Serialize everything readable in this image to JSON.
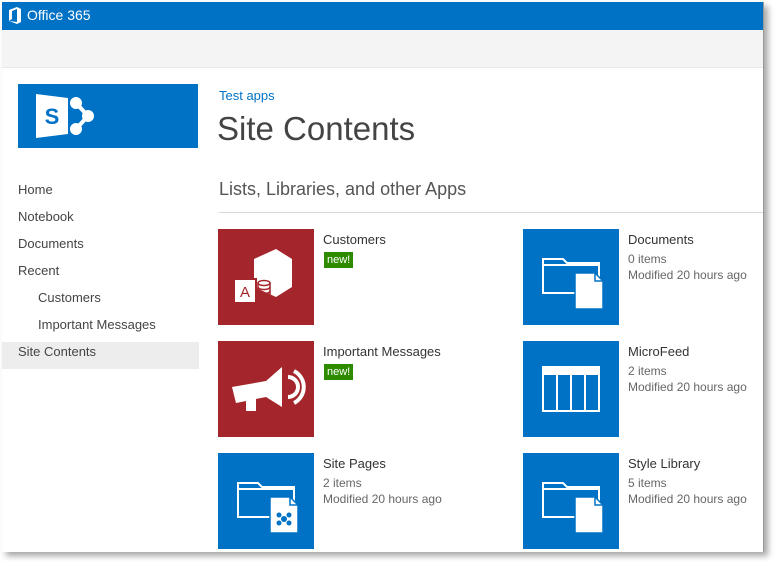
{
  "suite": {
    "brand": "Office 365"
  },
  "breadcrumb": "Test apps",
  "page_title": "Site Contents",
  "section_heading": "Lists, Libraries, and other Apps",
  "quicklaunch": {
    "items": [
      {
        "label": "Home"
      },
      {
        "label": "Notebook"
      },
      {
        "label": "Documents"
      },
      {
        "label": "Recent"
      },
      {
        "label": "Customers"
      },
      {
        "label": "Important Messages"
      },
      {
        "label": "Site Contents"
      }
    ]
  },
  "apps": [
    {
      "title": "Customers",
      "badge": "new!",
      "icon": "access-app-icon",
      "color": "#a4262c"
    },
    {
      "title": "Documents",
      "count": "0 items",
      "modified": "Modified 20 hours ago",
      "icon": "document-library-icon",
      "color": "#0072c6"
    },
    {
      "title": "Important Messages",
      "badge": "new!",
      "icon": "megaphone-icon",
      "color": "#a4262c"
    },
    {
      "title": "MicroFeed",
      "count": "2 items",
      "modified": "Modified 20 hours ago",
      "icon": "list-icon",
      "color": "#0072c6"
    },
    {
      "title": "Site Pages",
      "count": "2 items",
      "modified": "Modified 20 hours ago",
      "icon": "wiki-library-icon",
      "color": "#0072c6"
    },
    {
      "title": "Style Library",
      "count": "5 items",
      "modified": "Modified 20 hours ago",
      "icon": "document-library-icon",
      "color": "#0072c6"
    }
  ],
  "colors": {
    "suite_bar": "#0072c6",
    "accent": "#0072c6",
    "new_badge": "#2e8b00"
  }
}
